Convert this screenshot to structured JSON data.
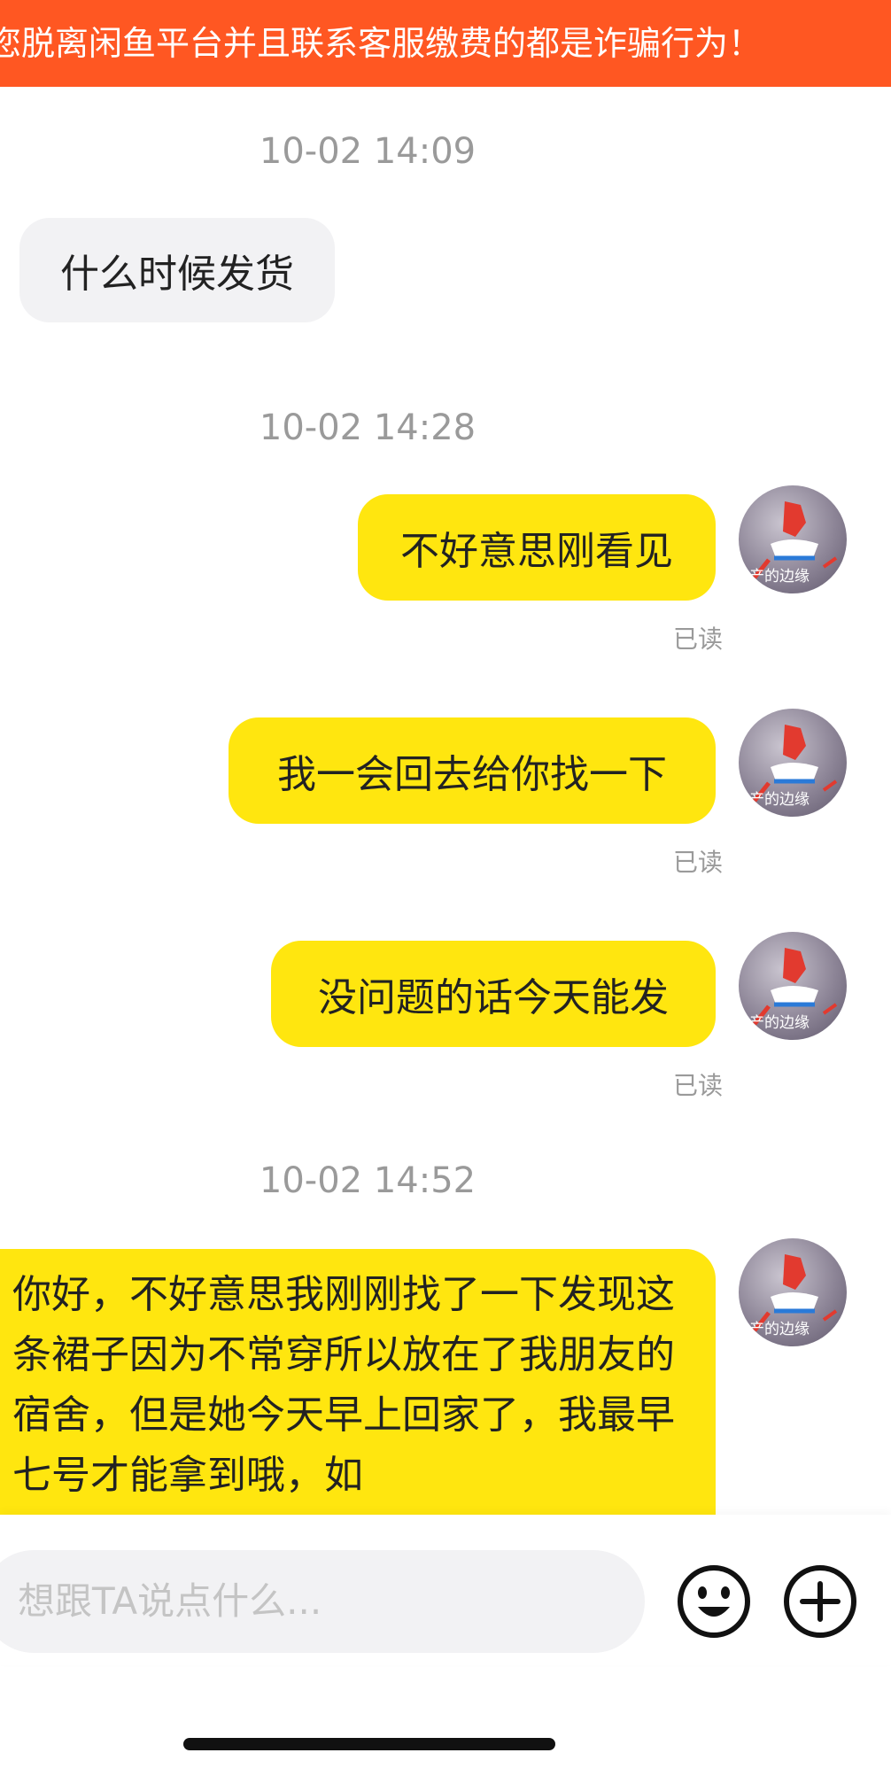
{
  "banner": {
    "text": "您脱离闲鱼平台并且联系客服缴费的都是诈骗行为！"
  },
  "messages": [
    {
      "timestamp": "10-02 14:09"
    },
    {
      "from": "other",
      "text": "什么时候发货"
    },
    {
      "timestamp": "10-02 14:28"
    },
    {
      "from": "me",
      "text": "不好意思刚看见",
      "status": "已读"
    },
    {
      "from": "me",
      "text": "我一会回去给你找一下",
      "status": "已读"
    },
    {
      "from": "me",
      "text": "没问题的话今天能发",
      "status": "已读"
    },
    {
      "timestamp": "10-02 14:52"
    },
    {
      "from": "me",
      "text": "你好，不好意思我刚刚找了一下发现这条裙子因为不常穿所以放在了我朋友的宿舍，但是她今天早上回家了，我最早七号才能拿到哦，如"
    }
  ],
  "avatar": {
    "caption": "产的边缘"
  },
  "input": {
    "placeholder": "想跟TA说点什么..."
  },
  "icons": {
    "emoji": "emoji-icon",
    "plus": "plus-icon"
  },
  "colors": {
    "banner": "#ff5722",
    "outgoing_bubble": "#ffe60f",
    "incoming_bubble": "#f2f2f4",
    "timestamp": "#9a9a9a"
  }
}
